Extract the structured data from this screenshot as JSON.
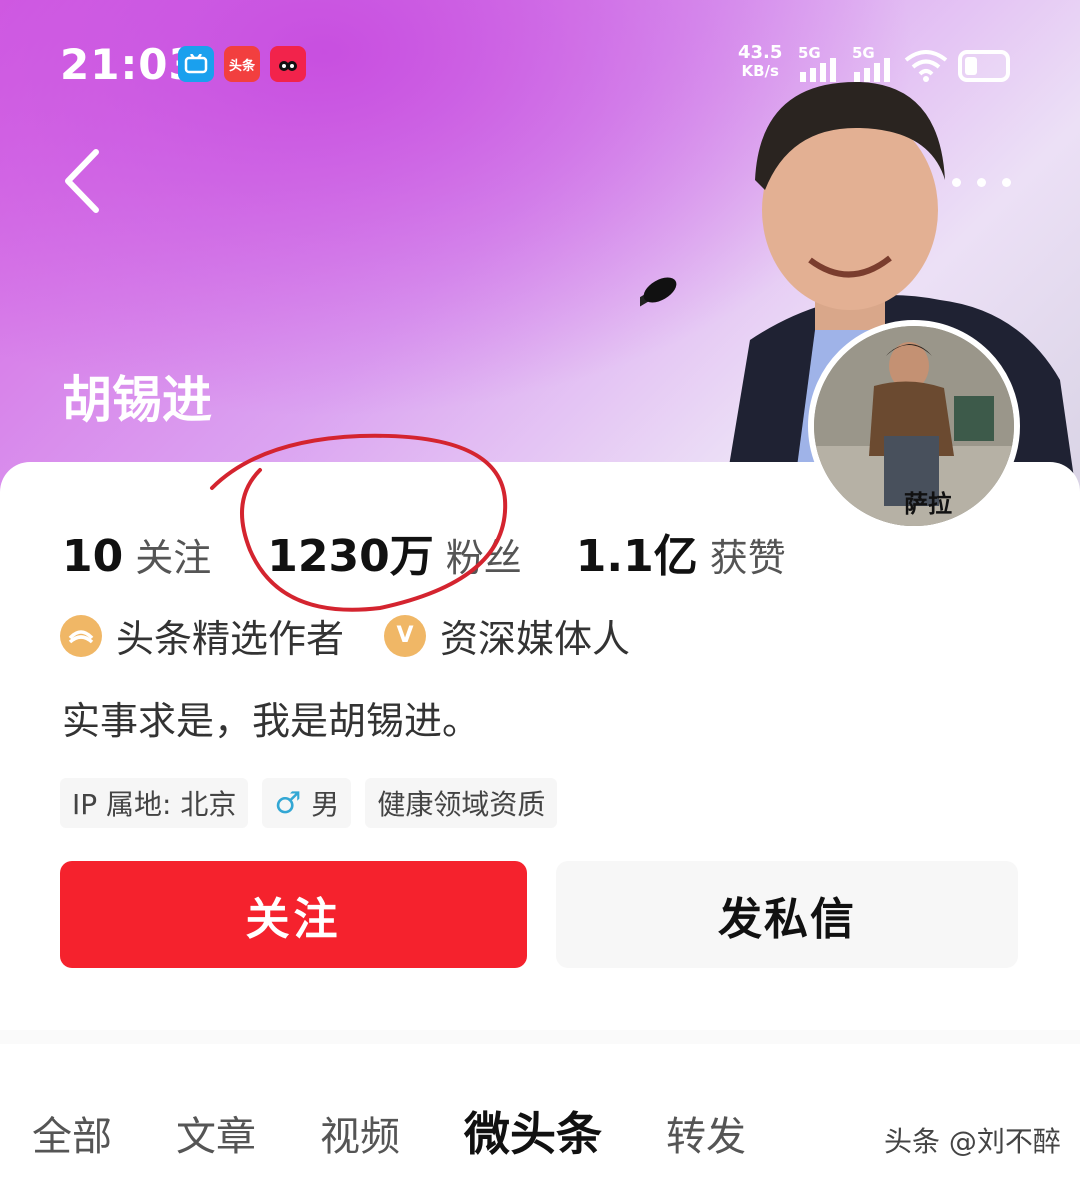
{
  "status_bar": {
    "time": "21:03",
    "apps": [
      "bilibili-icon",
      "toutiao-icon",
      "douyin-icon"
    ],
    "toutiao_label": "头条",
    "net_speed": "43.5",
    "net_unit": "KB/s",
    "sim1": "5G",
    "sim2": "5G"
  },
  "profile": {
    "name": "胡锡进",
    "avatar_caption": "萨拉",
    "stats": [
      {
        "value": "10",
        "label": "关注"
      },
      {
        "value": "1230万",
        "label": "粉丝"
      },
      {
        "value": "1.1亿",
        "label": "获赞"
      }
    ],
    "badges": [
      {
        "icon": "toutiao-author-icon",
        "label": "头条精选作者"
      },
      {
        "icon": "v-verified-icon",
        "label": "资深媒体人",
        "glyph": "V"
      }
    ],
    "bio": "实事求是，我是胡锡进。",
    "tags": {
      "ip": "IP 属地: 北京",
      "gender": "男",
      "qualification": "健康领域资质"
    }
  },
  "actions": {
    "follow": "关注",
    "message": "发私信"
  },
  "tabs": [
    "全部",
    "文章",
    "视频",
    "微头条",
    "转发"
  ],
  "active_tab": "微头条",
  "watermark": "头条 @刘不醉",
  "colors": {
    "accent": "#f5222d",
    "header_gradient_start": "#d45fe2",
    "annotation_circle": "#d4242f"
  }
}
